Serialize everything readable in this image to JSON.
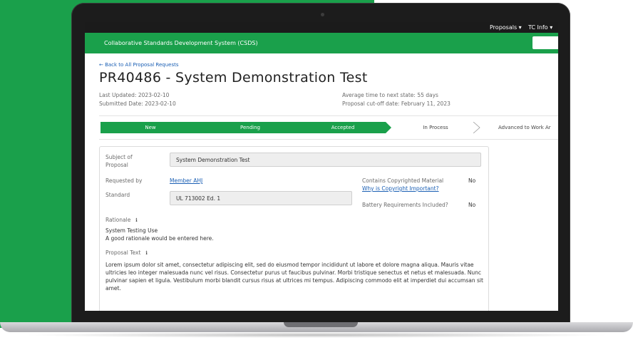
{
  "nav": {
    "proposals": "Proposals",
    "tc_info": "TC Info"
  },
  "app": {
    "title": "Collaborative Standards Development System (CSDS)"
  },
  "page": {
    "back_link": "← Back to All Proposal Requests",
    "title": "PR40486 - System Demonstration Test",
    "last_updated": "Last Updated: 2023-02-10",
    "submitted_date": "Submitted Date: 2023-02-10",
    "avg_time": "Average time to next state: 55 days",
    "cutoff": "Proposal cut-off date: February 11, 2023"
  },
  "steps": [
    {
      "label": "New",
      "status": "done"
    },
    {
      "label": "Pending",
      "status": "done"
    },
    {
      "label": "Accepted",
      "status": "done"
    },
    {
      "label": "In Process",
      "status": "todo"
    },
    {
      "label": "Advanced to Work Ar",
      "status": "todo"
    }
  ],
  "form": {
    "subject_label_1": "Subject of",
    "subject_label_2": "Proposal",
    "subject_value": "System Demonstration Test",
    "requested_by_label": "Requested by",
    "requested_by_value": "Member AHJ",
    "standard_label": "Standard",
    "standard_value": "UL 713002 Ed. 1",
    "copyright_label": "Contains Copyrighted Material",
    "copyright_value": "No",
    "copyright_link": "Why is Copyright Important?",
    "battery_label": "Battery Requirements Included?",
    "battery_value": "No",
    "rationale_label": "Rationale",
    "rationale_line1": "System Testing Use",
    "rationale_line2": "A good rationale would be entered here.",
    "proposal_text_label": "Proposal Text",
    "proposal_text": "Lorem ipsum dolor sit amet, consectetur adipiscing elit, sed do eiusmod tempor incididunt ut labore et dolore magna aliqua. Mauris vitae ultricies leo integer malesuada nunc vel risus. Consectetur purus ut faucibus pulvinar. Morbi tristique senectus et netus et malesuada. Nunc pulvinar sapien et ligula. Vestibulum morbi blandit cursus risus at ultrices mi tempus. Adipiscing commodo elit at imperdiet dui accumsan sit amet."
  },
  "colors": {
    "brand_green": "#1aa04b",
    "link_blue": "#1a5fb4",
    "nav_dark": "#1b1b1b"
  }
}
